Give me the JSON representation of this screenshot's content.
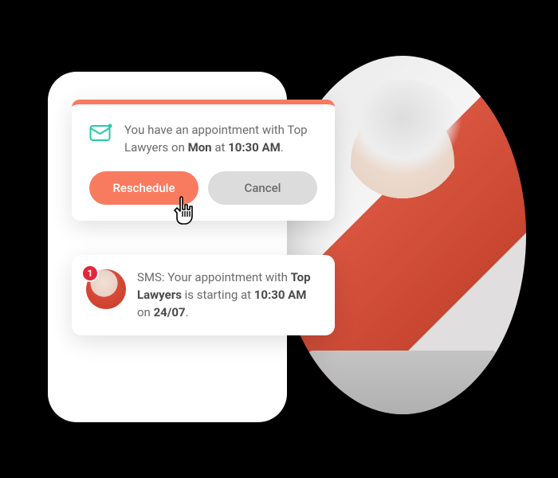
{
  "appointment": {
    "prefix": "You have an appointment with ",
    "company": "Top Lawyers",
    "mid1": " on ",
    "day": "Mon",
    "mid2": " at ",
    "time": "10:30 AM",
    "suffix": ".",
    "reschedule_label": "Reschedule",
    "cancel_label": "Cancel"
  },
  "sms": {
    "prefix": "SMS: Your appointment with ",
    "company": "Top Lawyers",
    "mid1": " is starting at ",
    "time": "10:30 AM",
    "mid2": " on ",
    "date": "24/07",
    "suffix": ".",
    "badge_count": "1"
  },
  "colors": {
    "accent": "#f97b5f",
    "badge": "#e6243a"
  }
}
